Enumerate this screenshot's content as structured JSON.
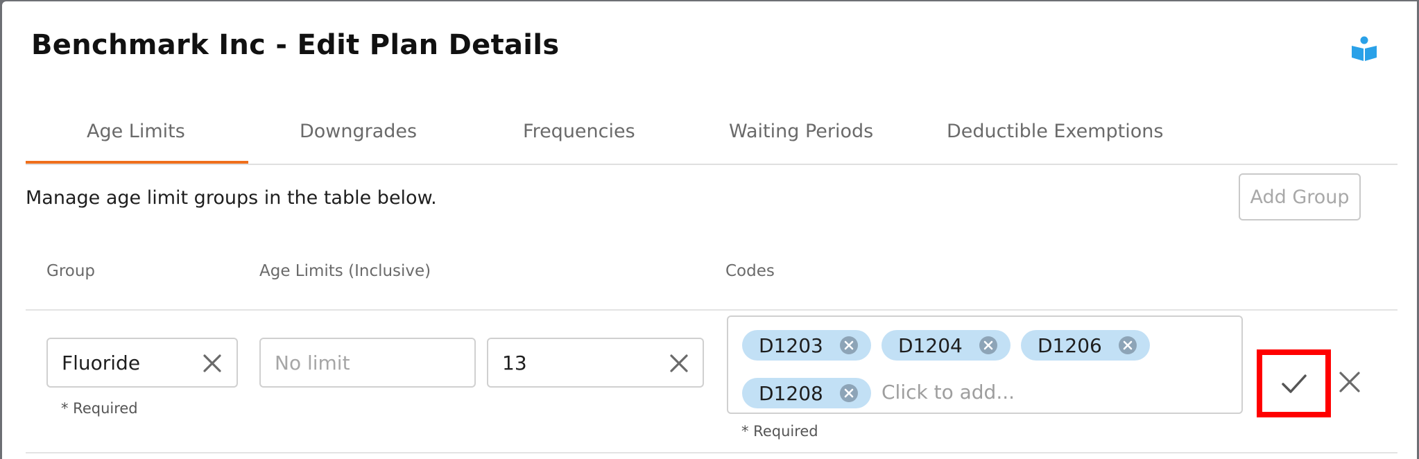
{
  "dialog": {
    "title": "Benchmark Inc - Edit Plan Details",
    "help_icon": "book-reader-icon",
    "accent_color": "#ef6f1c",
    "icon_color": "#2aa1e8"
  },
  "tabs": [
    {
      "label": "Age Limits",
      "active": true
    },
    {
      "label": "Downgrades",
      "active": false
    },
    {
      "label": "Frequencies",
      "active": false
    },
    {
      "label": "Waiting Periods",
      "active": false
    },
    {
      "label": "Deductible Exemptions",
      "active": false
    }
  ],
  "description": "Manage age limit groups in the table below.",
  "add_group_label": "Add Group",
  "table": {
    "headers": {
      "group": "Group",
      "age_limits": "Age Limits (Inclusive)",
      "codes": "Codes"
    },
    "row": {
      "group_value": "Fluoride",
      "group_required": "* Required",
      "age_min_placeholder": "No limit",
      "age_max_value": "13",
      "codes": [
        "D1203",
        "D1204",
        "D1206",
        "D1208"
      ],
      "codes_placeholder": "Click to add...",
      "codes_required": "* Required",
      "chip_color": "#c2e0f5",
      "confirm_icon": "checkmark-icon",
      "cancel_icon": "close-icon",
      "highlight_color": "#ff0000"
    }
  }
}
